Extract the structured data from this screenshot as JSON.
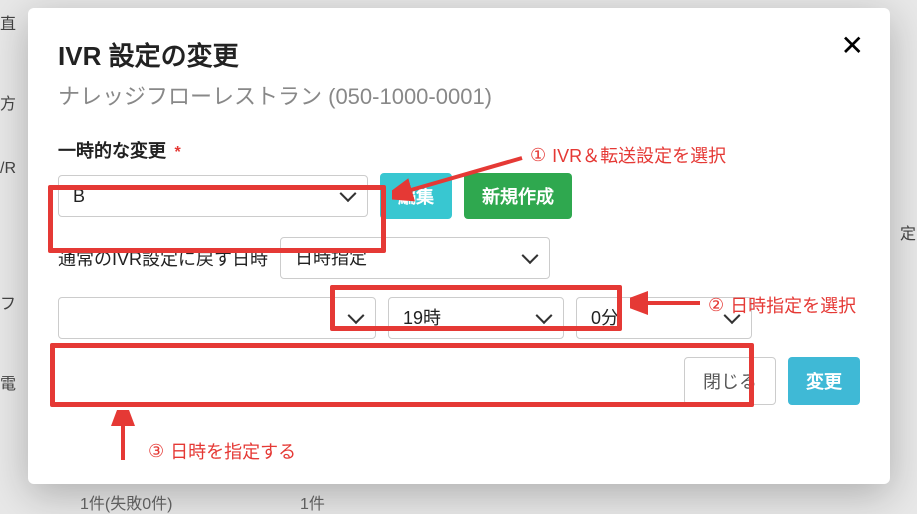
{
  "bg": {
    "f1": "直",
    "f2": "方",
    "f3": "/R",
    "f4": "定",
    "f5": "フ",
    "f6": "電",
    "f7": "1件(失敗0件)",
    "f8": "1件"
  },
  "dialog": {
    "title": "IVR 設定の変更",
    "subtitle": "ナレッジフローレストラン (050-1000-0001)",
    "temp_change_label": "一時的な変更",
    "required_mark": "*",
    "ivr_select_value": "B",
    "edit_label": "編集",
    "new_label": "新規作成",
    "revert_label": "通常のIVR設定に戻す日時",
    "datetype_value": "日時指定",
    "date_value": "",
    "hour_value": "19時",
    "min_value": "0分",
    "close_label": "閉じる",
    "change_label": "変更"
  },
  "annotations": {
    "a1": "IVR＆転送設定を選択",
    "a2": "日時指定を選択",
    "a3": "日時を指定する",
    "n1": "①",
    "n2": "②",
    "n3": "③"
  }
}
